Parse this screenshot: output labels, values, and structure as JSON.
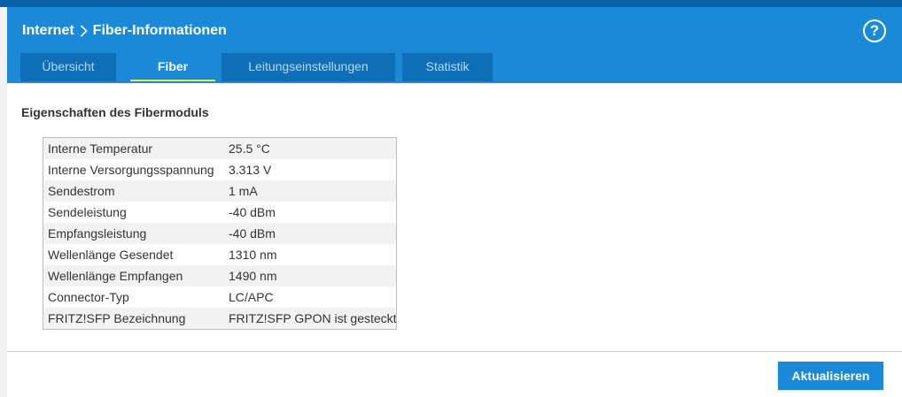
{
  "header": {
    "breadcrumb_parent": "Internet",
    "breadcrumb_current": "Fiber-Informationen",
    "help_label": "?"
  },
  "tabs": [
    {
      "label": "Übersicht",
      "active": false
    },
    {
      "label": "Fiber",
      "active": true
    },
    {
      "label": "Leitungseinstellungen",
      "active": false
    },
    {
      "label": "Statistik",
      "active": false
    }
  ],
  "main": {
    "section_title": "Eigenschaften des Fibermoduls",
    "properties": [
      {
        "label": "Interne Temperatur",
        "value": "25.5 °C"
      },
      {
        "label": "Interne Versorgungsspannung",
        "value": "3.313 V"
      },
      {
        "label": "Sendestrom",
        "value": "1 mA"
      },
      {
        "label": "Sendeleistung",
        "value": "-40 dBm"
      },
      {
        "label": "Empfangsleistung",
        "value": "-40 dBm"
      },
      {
        "label": "Wellenlänge Gesendet",
        "value": "1310 nm"
      },
      {
        "label": "Wellenlänge Empfangen",
        "value": "1490 nm"
      },
      {
        "label": "Connector-Typ",
        "value": "LC/APC"
      },
      {
        "label": "FRITZ!SFP Bezeichnung",
        "value": "FRITZ!SFP GPON ist gesteckt"
      }
    ]
  },
  "footer": {
    "refresh_label": "Aktualisieren"
  },
  "colors": {
    "header_blue": "#1a8ad8",
    "tab_inactive": "#0f6fb6",
    "tab_active_underline": "#e7e94a"
  }
}
